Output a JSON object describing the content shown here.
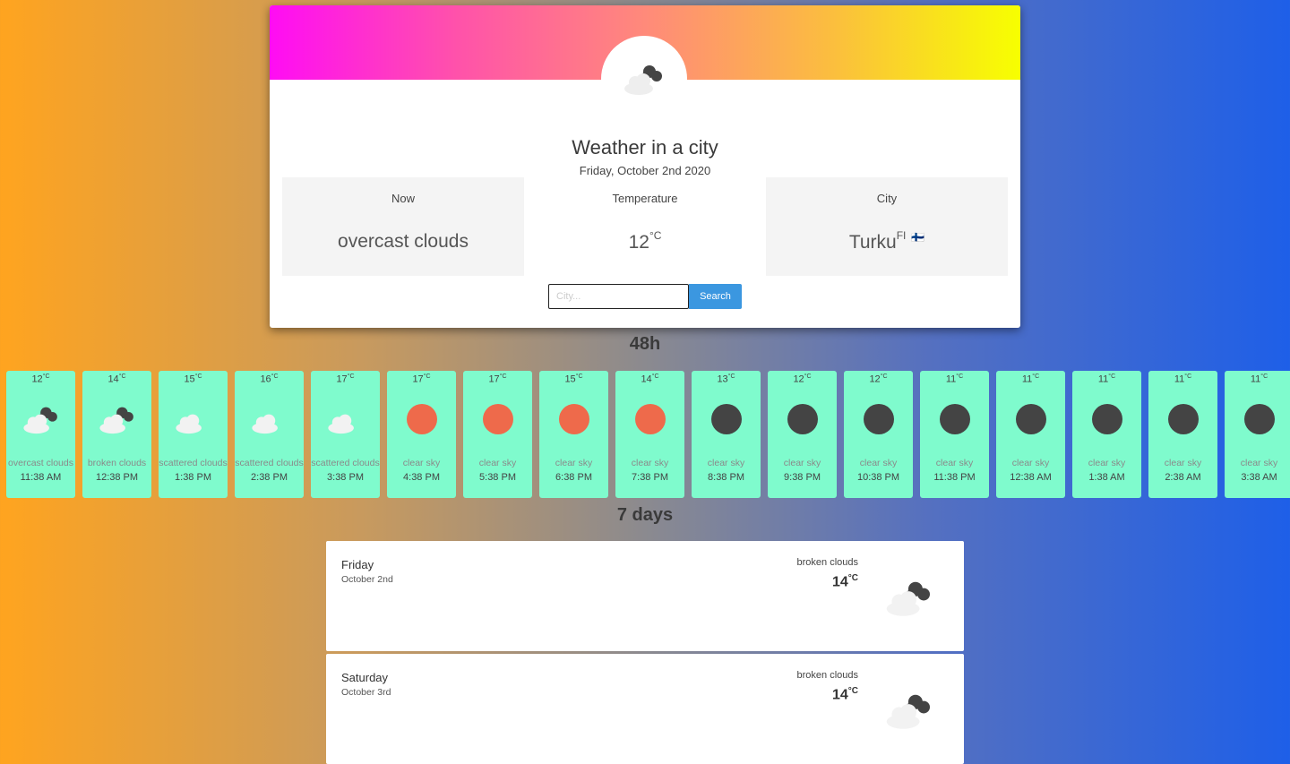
{
  "header": {
    "title": "Weather in a city",
    "date": "Friday, October 2nd 2020"
  },
  "stats": {
    "now_label": "Now",
    "now_value": "overcast clouds",
    "temp_label": "Temperature",
    "temp_value": "12",
    "temp_unit": "°C",
    "city_label": "City",
    "city_value": "Turku",
    "city_country": "FI",
    "city_flag": "🇫🇮"
  },
  "search": {
    "placeholder": "City...",
    "button_label": "Search"
  },
  "hourly_title": "48h",
  "hourly": [
    {
      "temp": "12",
      "unit": "°C",
      "icon": "overcast-clouds-icon",
      "desc": "overcast clouds",
      "time": "11:38 AM"
    },
    {
      "temp": "14",
      "unit": "°C",
      "icon": "broken-clouds-icon",
      "desc": "broken clouds",
      "time": "12:38 PM"
    },
    {
      "temp": "15",
      "unit": "°C",
      "icon": "scattered-clouds-icon",
      "desc": "scattered clouds",
      "time": "1:38 PM"
    },
    {
      "temp": "16",
      "unit": "°C",
      "icon": "scattered-clouds-icon",
      "desc": "scattered clouds",
      "time": "2:38 PM"
    },
    {
      "temp": "17",
      "unit": "°C",
      "icon": "scattered-clouds-icon",
      "desc": "scattered clouds",
      "time": "3:38 PM"
    },
    {
      "temp": "17",
      "unit": "°C",
      "icon": "sun-icon",
      "desc": "clear sky",
      "time": "4:38 PM"
    },
    {
      "temp": "17",
      "unit": "°C",
      "icon": "sun-icon",
      "desc": "clear sky",
      "time": "5:38 PM"
    },
    {
      "temp": "15",
      "unit": "°C",
      "icon": "sun-icon",
      "desc": "clear sky",
      "time": "6:38 PM"
    },
    {
      "temp": "14",
      "unit": "°C",
      "icon": "sun-icon",
      "desc": "clear sky",
      "time": "7:38 PM"
    },
    {
      "temp": "13",
      "unit": "°C",
      "icon": "moon-icon",
      "desc": "clear sky",
      "time": "8:38 PM"
    },
    {
      "temp": "12",
      "unit": "°C",
      "icon": "moon-icon",
      "desc": "clear sky",
      "time": "9:38 PM"
    },
    {
      "temp": "12",
      "unit": "°C",
      "icon": "moon-icon",
      "desc": "clear sky",
      "time": "10:38 PM"
    },
    {
      "temp": "11",
      "unit": "°C",
      "icon": "moon-icon",
      "desc": "clear sky",
      "time": "11:38 PM"
    },
    {
      "temp": "11",
      "unit": "°C",
      "icon": "moon-icon",
      "desc": "clear sky",
      "time": "12:38 AM"
    },
    {
      "temp": "11",
      "unit": "°C",
      "icon": "moon-icon",
      "desc": "clear sky",
      "time": "1:38 AM"
    },
    {
      "temp": "11",
      "unit": "°C",
      "icon": "moon-icon",
      "desc": "clear sky",
      "time": "2:38 AM"
    },
    {
      "temp": "11",
      "unit": "°C",
      "icon": "moon-icon",
      "desc": "clear sky",
      "time": "3:38 AM"
    }
  ],
  "daily_title": "7 days",
  "daily": [
    {
      "day": "Friday",
      "date": "October 2nd",
      "desc": "broken clouds",
      "temp": "14",
      "unit": "°C",
      "icon": "broken-clouds-icon"
    },
    {
      "day": "Saturday",
      "date": "October 3rd",
      "desc": "broken clouds",
      "temp": "14",
      "unit": "°C",
      "icon": "broken-clouds-icon"
    }
  ],
  "colors": {
    "hour_card": "#7ffbcd",
    "sun": "#ee6a4b",
    "moon": "#444444",
    "search_button": "#3b97e0"
  }
}
